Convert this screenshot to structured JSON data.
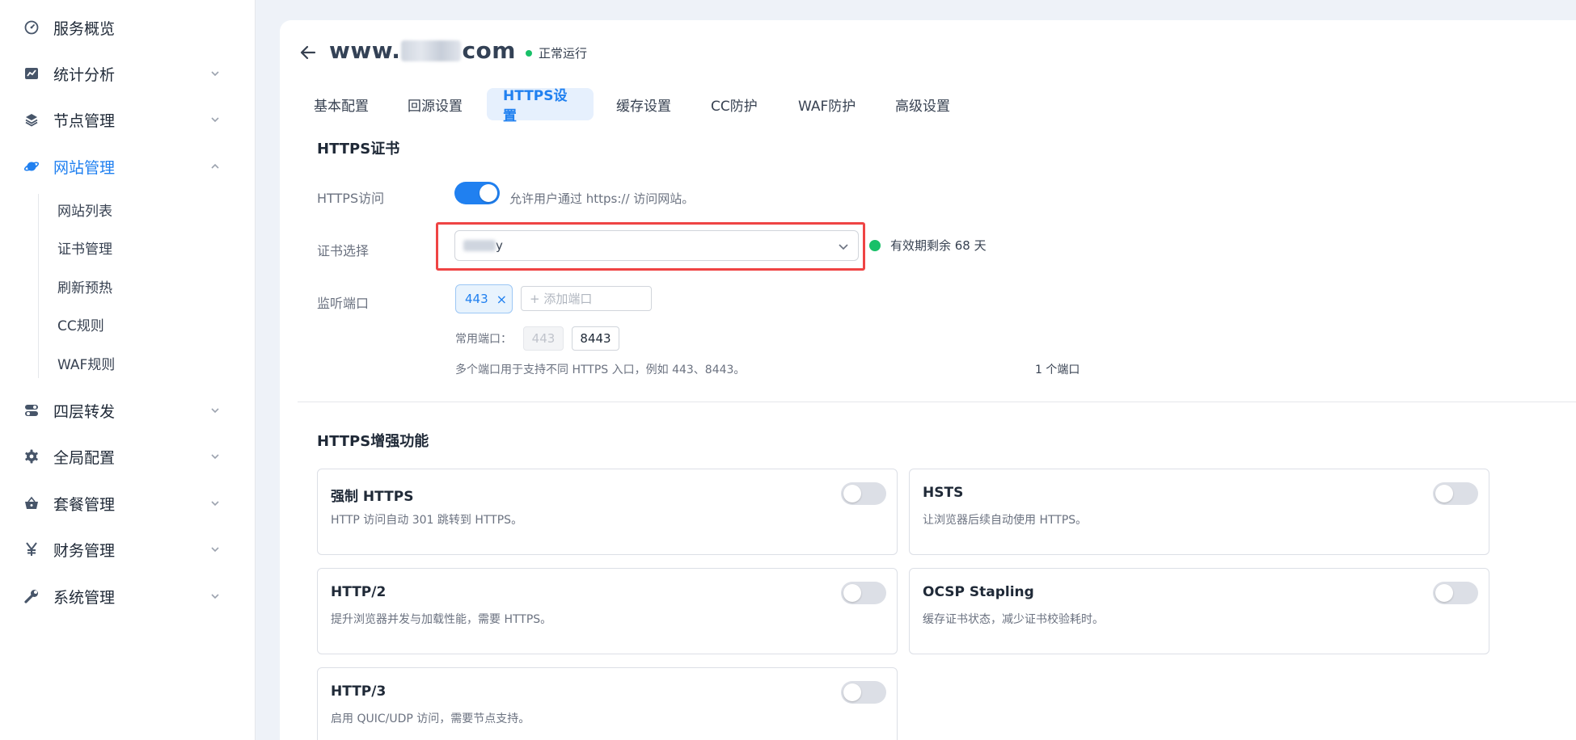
{
  "sidebar": {
    "items": [
      {
        "label": "服务概览",
        "icon": "dashboard-icon",
        "has_chevron": false
      },
      {
        "label": "统计分析",
        "icon": "chart-icon",
        "has_chevron": true
      },
      {
        "label": "节点管理",
        "icon": "layers-icon",
        "has_chevron": true
      },
      {
        "label": "网站管理",
        "icon": "planet-icon",
        "has_chevron": true,
        "active": true
      },
      {
        "label": "四层转发",
        "icon": "toggle-icon",
        "has_chevron": true
      },
      {
        "label": "全局配置",
        "icon": "gear-icon",
        "has_chevron": true
      },
      {
        "label": "套餐管理",
        "icon": "basket-icon",
        "has_chevron": true
      },
      {
        "label": "财务管理",
        "icon": "yen-icon",
        "has_chevron": true
      },
      {
        "label": "系统管理",
        "icon": "wrench-icon",
        "has_chevron": true
      }
    ],
    "sub_items": [
      "网站列表",
      "证书管理",
      "刷新预热",
      "CC规则",
      "WAF规则"
    ]
  },
  "header": {
    "title_prefix": "www.",
    "title_suffix": "com",
    "status": "正常运行"
  },
  "tabs": [
    "基本配置",
    "回源设置",
    "HTTPS设置",
    "缓存设置",
    "CC防护",
    "WAF防护",
    "高级设置"
  ],
  "active_tab": "HTTPS设置",
  "cert_section": {
    "title": "HTTPS证书",
    "https_access_label": "HTTPS访问",
    "https_access_on": true,
    "https_access_help": "允许用户通过 https:// 访问网站。",
    "cert_select_label": "证书选择",
    "cert_select_value_suffix": "y",
    "validity": "有效期剩余 68 天",
    "listen_port_label": "监听端口",
    "port_tag": "443",
    "port_tag_remove": "×",
    "add_port_placeholder": "+ 添加端口",
    "common_ports_label": "常用端口：",
    "common_ports": [
      "443",
      "8443"
    ],
    "note": "多个端口用于支持不同 HTTPS 入口，例如 443、8443。",
    "port_count": "1 个端口"
  },
  "enhance_section": {
    "title": "HTTPS增强功能",
    "features": [
      {
        "title": "强制 HTTPS",
        "desc": "HTTP 访问自动 301 跳转到 HTTPS。",
        "enabled": false
      },
      {
        "title": "HSTS",
        "desc": "让浏览器后续自动使用 HTTPS。",
        "enabled": false
      },
      {
        "title": "HTTP/2",
        "desc": "提升浏览器并发与加载性能，需要 HTTPS。",
        "enabled": false
      },
      {
        "title": "OCSP Stapling",
        "desc": "缓存证书状态，减少证书校验耗时。",
        "enabled": false
      },
      {
        "title": "HTTP/3",
        "desc": "启用 QUIC/UDP 访问，需要节点支持。",
        "enabled": false
      }
    ]
  },
  "colors": {
    "accent": "#2080f0",
    "success": "#18c068",
    "highlight_border": "#ef4444"
  }
}
